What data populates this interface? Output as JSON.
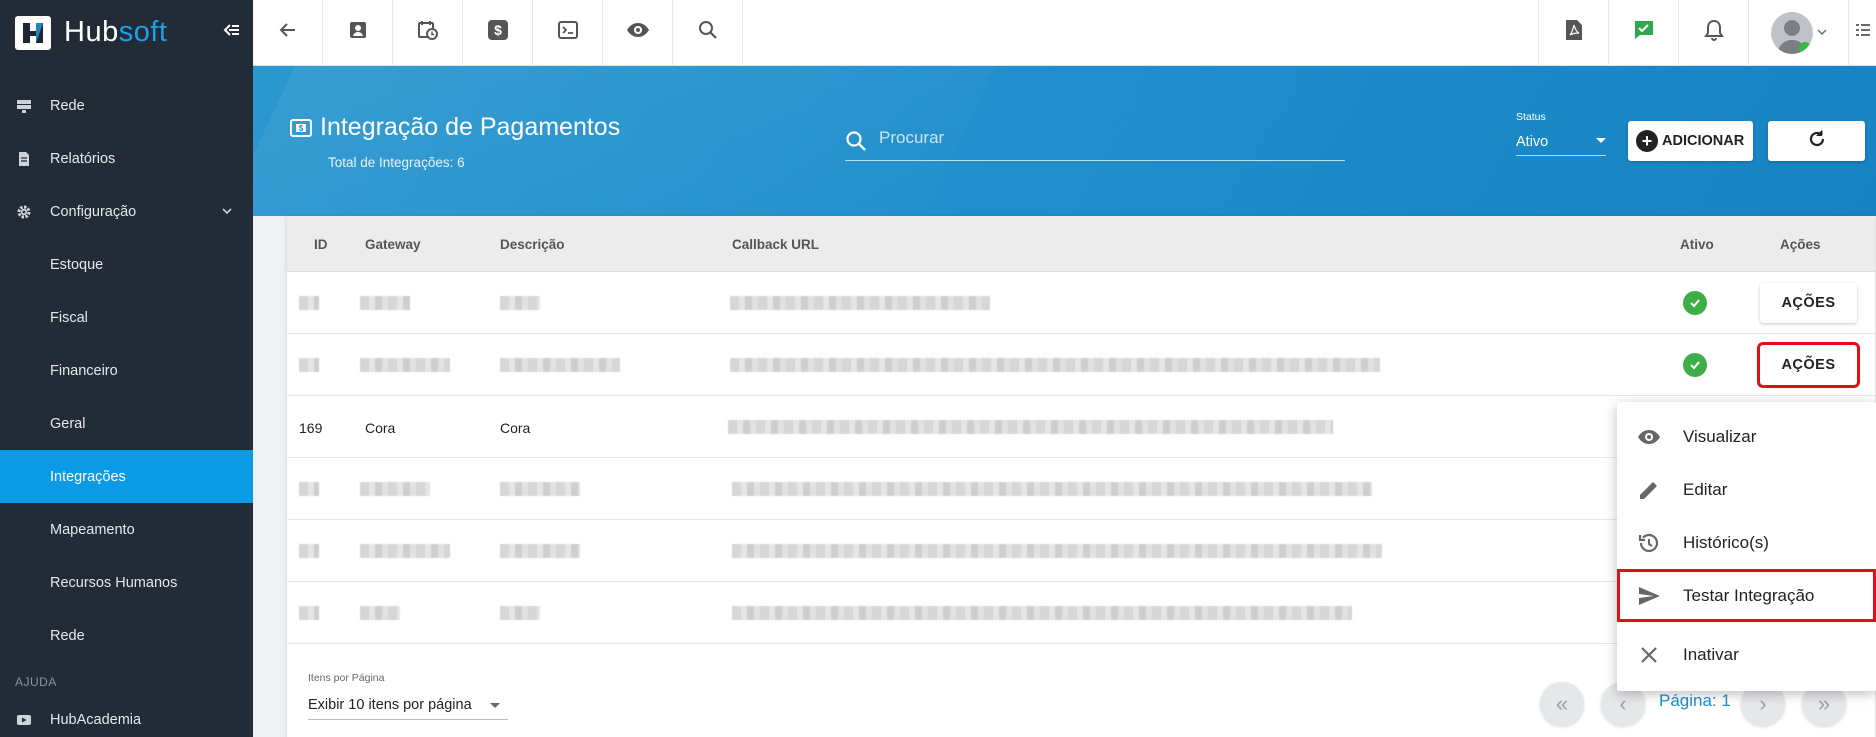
{
  "brand": {
    "name_part1": "Hub",
    "name_part2": "soft"
  },
  "sidebar": {
    "items": [
      {
        "label": "Rede",
        "icon": "server-icon"
      },
      {
        "label": "Relatórios",
        "icon": "document-icon"
      },
      {
        "label": "Configuração",
        "icon": "gear-icon"
      },
      {
        "label": "Estoque"
      },
      {
        "label": "Fiscal"
      },
      {
        "label": "Financeiro"
      },
      {
        "label": "Geral"
      },
      {
        "label": "Integrações",
        "active": true
      },
      {
        "label": "Mapeamento"
      },
      {
        "label": "Recursos Humanos"
      },
      {
        "label": "Rede"
      }
    ],
    "section_help": "AJUDA",
    "help_item": "HubAcademia"
  },
  "header": {
    "title": "Integração de Pagamentos",
    "subtitle": "Total de Integrações: 6",
    "search_placeholder": "Procurar",
    "status_label": "Status",
    "status_value": "Ativo",
    "add_label": "ADICIONAR"
  },
  "table": {
    "columns": [
      "ID",
      "Gateway",
      "Descrição",
      "Callback URL",
      "Ativo",
      "Ações"
    ],
    "visible_row": {
      "id": "169",
      "gateway": "Cora",
      "descricao": "Cora"
    },
    "action_label": "AÇÕES"
  },
  "pagination": {
    "items_label": "Itens por Página",
    "items_value": "Exibir 10 itens por página",
    "page_text": "Página: 1"
  },
  "menu": {
    "items": [
      {
        "label": "Visualizar",
        "icon": "eye-icon"
      },
      {
        "label": "Editar",
        "icon": "pencil-icon"
      },
      {
        "label": "Histórico(s)",
        "icon": "history-icon"
      },
      {
        "label": "Testar Integração",
        "icon": "send-icon",
        "highlighted": true
      },
      {
        "label": "Inativar",
        "icon": "close-icon"
      }
    ]
  },
  "colors": {
    "accent": "#0b9ae6",
    "sidebar": "#232b36",
    "success": "#3fae49",
    "highlight": "#e0101a"
  }
}
